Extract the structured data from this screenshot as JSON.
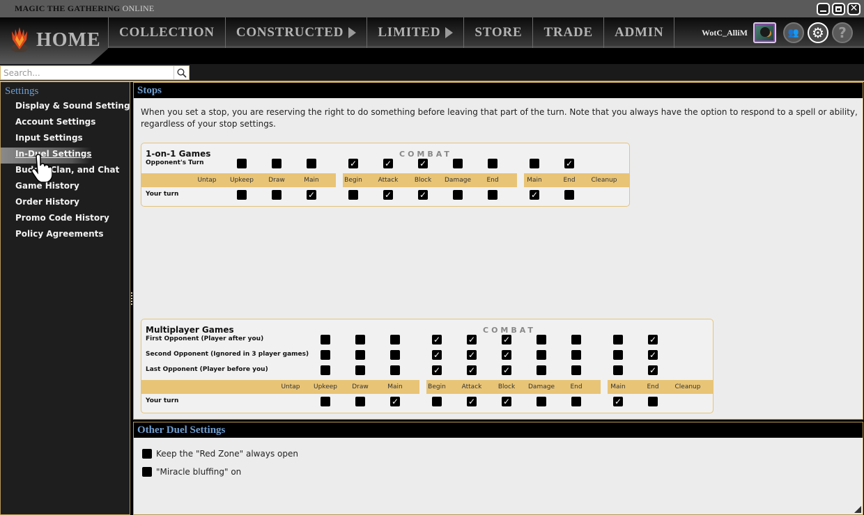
{
  "app": {
    "title_main": "MAGIC THE GATHERING",
    "title_suffix": "ONLINE",
    "window_controls": [
      "minimize-icon",
      "maximize-icon",
      "close-icon"
    ]
  },
  "nav": {
    "home_label": "HOME",
    "items": [
      {
        "label": "COLLECTION",
        "has_arrow": false
      },
      {
        "label": "CONSTRUCTED",
        "has_arrow": true
      },
      {
        "label": "LIMITED",
        "has_arrow": true
      },
      {
        "label": "STORE",
        "has_arrow": false
      },
      {
        "label": "TRADE",
        "has_arrow": false
      },
      {
        "label": "ADMIN",
        "has_arrow": false
      }
    ],
    "username": "WotC_AlliM",
    "social_icon": "people-icon",
    "settings_icon": "gear-icon",
    "help_icon": "?"
  },
  "search": {
    "placeholder": "Search...",
    "value": ""
  },
  "sidebar": {
    "title": "Settings",
    "items": [
      {
        "label": "Display & Sound Settings",
        "active": false
      },
      {
        "label": "Account Settings",
        "active": false
      },
      {
        "label": "Input Settings",
        "active": false
      },
      {
        "label": "In-Duel Settings",
        "active": true
      },
      {
        "label": "Buddy, Clan, and Chat",
        "active": false
      },
      {
        "label": "Game History",
        "active": false
      },
      {
        "label": "Order History",
        "active": false
      },
      {
        "label": "Promo Code History",
        "active": false
      },
      {
        "label": "Policy Agreements",
        "active": false
      }
    ]
  },
  "stops": {
    "title": "Stops",
    "description": "When you set a stop, you are reserving the right to do something before leaving that part of the turn. Note that you always have the option to respond to a spell or ability, regardless of your stop settings.",
    "combat_label": "COMBAT",
    "phases": [
      "Untap",
      "Upkeep",
      "Draw",
      "Main",
      "Begin",
      "Attack",
      "Block",
      "Damage",
      "End",
      "Main",
      "End",
      "Cleanup"
    ],
    "one_on_one": {
      "title": "1-on-1 Games",
      "opponent_rows": [
        {
          "label": "Opponent's Turn",
          "checks": [
            false,
            false,
            false,
            true,
            true,
            true,
            false,
            false,
            false,
            true
          ]
        }
      ],
      "your_turn": {
        "label": "Your turn",
        "checks": [
          false,
          false,
          true,
          false,
          true,
          true,
          false,
          false,
          true,
          false
        ]
      }
    },
    "multiplayer": {
      "title": "Multiplayer Games",
      "opponent_rows": [
        {
          "label": "First Opponent (Player after you)",
          "checks": [
            false,
            false,
            false,
            true,
            true,
            true,
            false,
            false,
            false,
            true
          ]
        },
        {
          "label": "Second Opponent (Ignored in 3 player games)",
          "checks": [
            false,
            false,
            false,
            true,
            true,
            true,
            false,
            false,
            false,
            true
          ]
        },
        {
          "label": "Last Opponent (Player before you)",
          "checks": [
            false,
            false,
            false,
            true,
            true,
            true,
            false,
            false,
            false,
            true
          ]
        }
      ],
      "your_turn": {
        "label": "Your turn",
        "checks": [
          false,
          false,
          true,
          false,
          true,
          true,
          false,
          false,
          true,
          false
        ]
      }
    }
  },
  "other": {
    "title": "Other Duel Settings",
    "options": [
      {
        "label": "Keep the \"Red Zone\" always open",
        "checked": false
      },
      {
        "label": "\"Miracle bluffing\" on",
        "checked": false
      }
    ]
  }
}
